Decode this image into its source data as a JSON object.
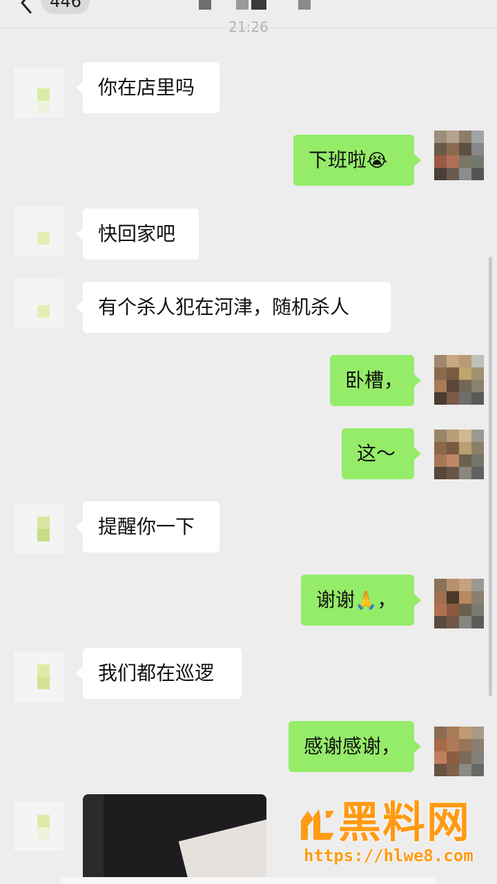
{
  "header": {
    "unread_count": "446",
    "timestamp": "21:26"
  },
  "messages": [
    {
      "side": "in",
      "text": "你在店里吗"
    },
    {
      "side": "out",
      "text": "下班啦",
      "emoji": "😭"
    },
    {
      "side": "in",
      "text": "快回家吧"
    },
    {
      "side": "in",
      "text": "有个杀人犯在河津，随机杀人"
    },
    {
      "side": "out",
      "text": "卧槽，"
    },
    {
      "side": "out",
      "text": "这～"
    },
    {
      "side": "in",
      "text": "提醒你一下"
    },
    {
      "side": "out",
      "text": "谢谢",
      "emoji": "🙏",
      "suffix": "，"
    },
    {
      "side": "in",
      "text": "我们都在巡逻"
    },
    {
      "side": "out",
      "text": "感谢感谢，"
    },
    {
      "side": "in",
      "type": "image"
    }
  ],
  "colors": {
    "background": "#ededed",
    "incoming_bubble": "#ffffff",
    "outgoing_bubble": "#95ec69",
    "watermark": "#ff9a12"
  },
  "icons": [
    "back-arrow-icon",
    "more-options-icon"
  ],
  "watermark": {
    "brand": "黑料网",
    "url": "https://hlwe8.com"
  }
}
